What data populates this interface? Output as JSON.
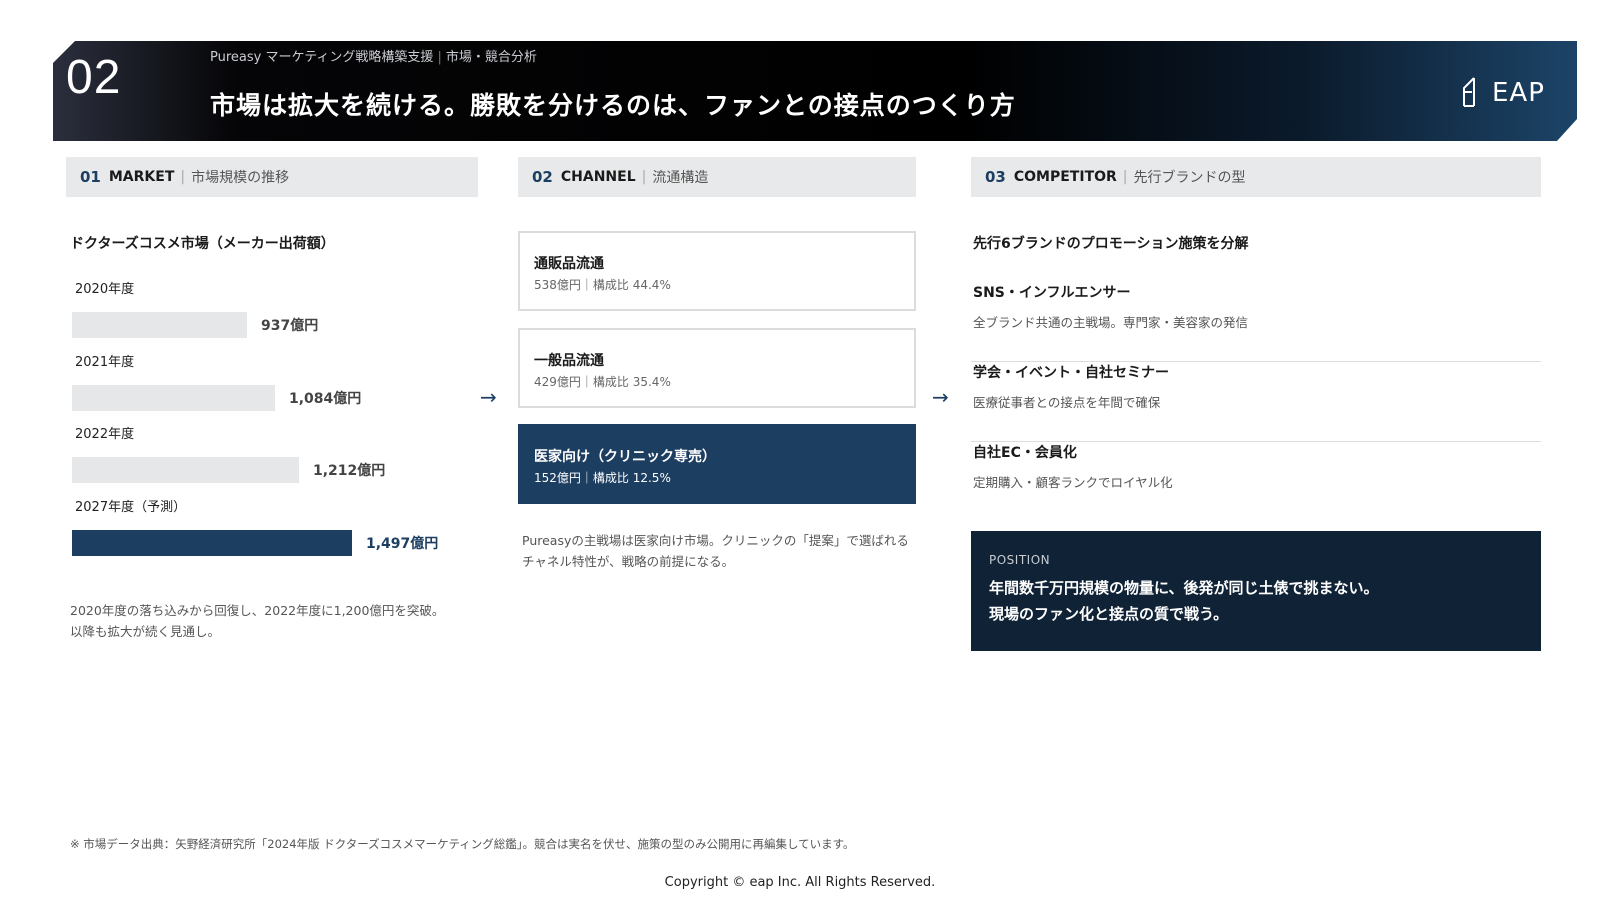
{
  "header": {
    "number": "02",
    "subtitle_brand": "Pureasy マーケティング戦略構築支援",
    "subtitle_section": "市場・競合分析",
    "title": "市場は拡大を続ける。勝敗を分けるのは、ファンとの接点のつくり方",
    "logo_text": "EAP"
  },
  "sections": [
    {
      "num": "01",
      "en": "MARKET",
      "jp": "市場規模の推移"
    },
    {
      "num": "02",
      "en": "CHANNEL",
      "jp": "流通構造"
    },
    {
      "num": "03",
      "en": "COMPETITOR",
      "jp": "先行ブランドの型"
    }
  ],
  "market": {
    "title": "ドクターズコスメ市場（メーカー出荷額）",
    "bars": [
      {
        "year": "2020年度",
        "value": 937,
        "label": "937億円",
        "highlight": false
      },
      {
        "year": "2021年度",
        "value": 1084,
        "label": "1,084億円",
        "highlight": false
      },
      {
        "year": "2022年度",
        "value": 1212,
        "label": "1,212億円",
        "highlight": false
      },
      {
        "year": "2027年度（予測）",
        "value": 1497,
        "label": "1,497億円",
        "highlight": true
      }
    ],
    "note_line1": "2020年度の落ち込みから回復し、2022年度に1,200億円を突破。",
    "note_line2": "以降も拡大が続く見通し。"
  },
  "channel": {
    "items": [
      {
        "name": "通販品流通",
        "meta": "538億円｜構成比 44.4%",
        "highlight": false
      },
      {
        "name": "一般品流通",
        "meta": "429億円｜構成比 35.4%",
        "highlight": false
      },
      {
        "name": "医家向け（クリニック専売）",
        "meta": "152億円｜構成比 12.5%",
        "highlight": true
      }
    ],
    "note": "Pureasyの主戦場は医家向け市場。クリニックの「提案」で選ばれるチャネル特性が、戦略の前提になる。"
  },
  "competitor": {
    "title": "先行6ブランドのプロモーション施策を分解",
    "items": [
      {
        "name": "SNS・インフルエンサー",
        "desc": "全ブランド共通の主戦場。専門家・美容家の発信"
      },
      {
        "name": "学会・イベント・自社セミナー",
        "desc": "医療従事者との接点を年間で確保"
      },
      {
        "name": "自社EC・会員化",
        "desc": "定期購入・顧客ランクでロイヤル化"
      }
    ],
    "position_label": "POSITION",
    "position_line1": "年間数千万円規模の物量に、後発が同じ土俵で挑まない。",
    "position_line2": "現場のファン化と接点の質で戦う。"
  },
  "arrow_glyph": "→",
  "footer": {
    "source": "※ 市場データ出典：矢野経済研究所「2024年版 ドクターズコスメマーケティング総鑑」。競合は実名を伏せ、施策の型のみ公開用に再編集しています。",
    "copyright": "Copyright © eap Inc. All Rights Reserved."
  },
  "colors": {
    "accent": "#1c3e61",
    "dark": "#0f2236",
    "bar_gray": "#e6e7e8"
  }
}
